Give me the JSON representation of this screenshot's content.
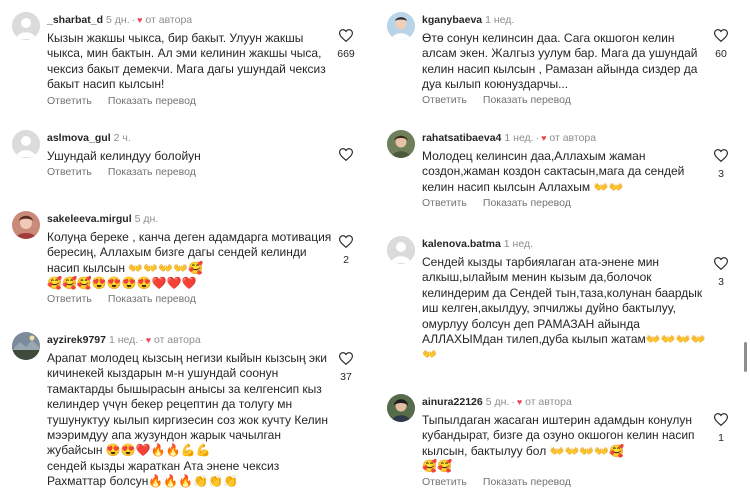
{
  "comments_left": [
    {
      "username": "_sharbat_d",
      "time": "5 дн.",
      "author_label": "от автора",
      "text": "Кызын жакшы чыкса, бир бакыт. Улуун жакшы чыкса, мин бактын. Ал эми келинин жакшы чыса, чексиз бакыт демекчи. Мага дагы ушундай чексиз бакыт насип кылсын!",
      "likes": "669",
      "avatar": "blank-avatar-icon"
    },
    {
      "username": "aslmova_gul",
      "time": "2 ч.",
      "text": "Ушундай келиндуу болойун",
      "likes": "",
      "avatar": "blank-avatar-icon"
    },
    {
      "username": "sakeleeva.mirgul",
      "time": "5 дн.",
      "text": "Колуңа береке , канча деген адамдарга мотивация бересиң, Аллахым бизге дагы сендей келинди насип кылсын 👐👐👐👐🥰\n🥰🥰🥰😍😍😍😍❤️❤️❤️",
      "likes": "2",
      "avatar": "photo-avatar-icon"
    },
    {
      "username": "ayzirek9797",
      "time": "1 нед.",
      "author_label": "от автора",
      "text": "Арапат молодец кызсың негизи кыйын кызсың эки кичинекей кыздарын м-н ушундай соонун тамактарды бышырасын анысы за келгенсип кыз келиндер үчүн бекер рецептин да толугу мн тушунуктуу кылып киргизесин соз  жок кучту Келин мээримдуу апа жузундон жарык чачылган жубайсын 😍😍❤️🔥🔥💪💪\nсендей кызды жараткан Ата энене чексиз Рахматтар болсун🔥🔥🔥👏👏👏",
      "likes": "37",
      "avatar": "photo-avatar-icon"
    }
  ],
  "comments_right": [
    {
      "username": "kganybaeva",
      "time": "1 нед.",
      "text": "Өтө сонун келинсин даа. Сага окшогон келин алсам экен. Жалгыз уулум бар. Мага да ушундай келин насип кылсын , Рамазан айында сиздер да дуа кылып коюнуздарчы...",
      "likes": "60",
      "avatar": "photo-avatar-icon"
    },
    {
      "username": "rahatsatibaeva4",
      "time": "1 нед.",
      "author_label": "от автора",
      "text": "Молодец келинсин даа,Аллахым жаман создон,жаман коздон сактасын,мага да сендей келин насип кылсын Аллахым 👐👐",
      "likes": "3",
      "avatar": "photo-avatar-icon"
    },
    {
      "username": "kalenova.batma",
      "time": "1 нед.",
      "text": "Сендей кызды тарбиялаган ата-энене мин алкыш,ылайым менин кызым да,болочок келиндерим да Сендей тын,таза,колунан баардык иш келген,акылдуу, эпчилжы дуйно бактылуу, омурлуу болсун деп РАМАЗАН айында АЛЛАХЫМдан тилеп,дуба кылып жатам👐👐👐👐👐",
      "likes": "3",
      "avatar": "blank-avatar-icon"
    },
    {
      "username": "ainura22126",
      "time": "5 дн.",
      "author_label": "от автора",
      "text": "Тыпылдаган жасаган иштерин адамдын конулун кубандырат, бизге да озуно окшогон келин насип кылсын, бактылуу бол 👐👐👐👐🥰\n🥰🥰",
      "likes": "1",
      "avatar": "photo-avatar-icon"
    }
  ],
  "actions": {
    "reply": "Ответить",
    "translate": "Показать перевод"
  },
  "colors": {
    "text": "#262626",
    "muted": "#737373",
    "heart": "#ed4956",
    "background": "#ffffff"
  }
}
